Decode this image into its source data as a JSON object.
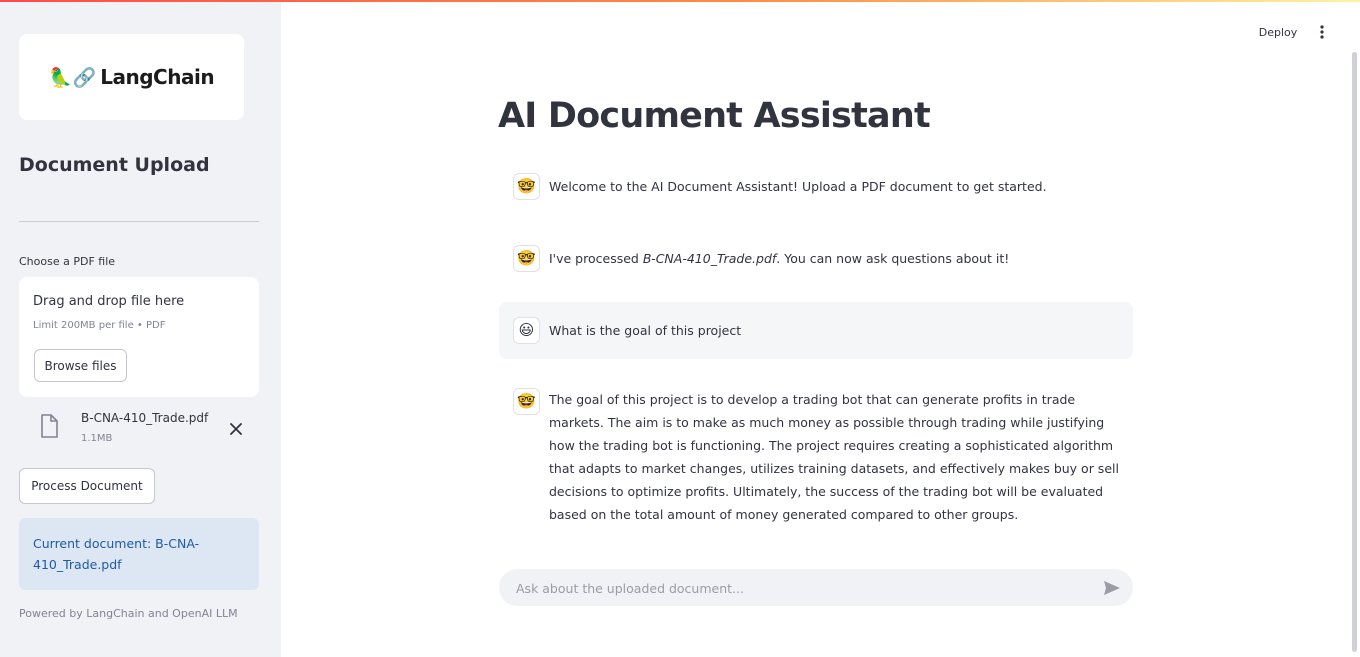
{
  "sidebar": {
    "logo": {
      "emoji": "🦜🔗",
      "text": "LangChain"
    },
    "heading": "Document Upload",
    "uploader": {
      "label": "Choose a PDF file",
      "drag_text": "Drag and drop file here",
      "limit_text": "Limit 200MB per file • PDF",
      "browse_label": "Browse files"
    },
    "file": {
      "name": "B-CNA-410_Trade.pdf",
      "size": "1.1MB"
    },
    "process_label": "Process Document",
    "current_doc": "Current document: B-CNA-410_Trade.pdf",
    "footer": "Powered by LangChain and OpenAI LLM"
  },
  "header": {
    "deploy_label": "Deploy"
  },
  "main": {
    "title": "AI Document Assistant",
    "messages": [
      {
        "role": "assistant",
        "avatar": "🤓",
        "text": "Welcome to the AI Document Assistant! Upload a PDF document to get started."
      },
      {
        "role": "assistant",
        "avatar": "🤓",
        "prefix": "I've processed ",
        "emphasis": "B-CNA-410_Trade.pdf",
        "suffix": ". You can now ask questions about it!"
      },
      {
        "role": "user",
        "avatar": "😃",
        "text": "What is the goal of this project"
      },
      {
        "role": "assistant",
        "avatar": "🤓",
        "text": "The goal of this project is to develop a trading bot that can generate profits in trade markets. The aim is to make as much money as possible through trading while justifying how the trading bot is functioning. The project requires creating a sophisticated algorithm that adapts to market changes, utilizes training datasets, and effectively makes buy or sell decisions to optimize profits. Ultimately, the success of the trading bot will be evaluated based on the total amount of money generated compared to other groups."
      }
    ],
    "chat_input": {
      "placeholder": "Ask about the uploaded document...",
      "value": ""
    }
  }
}
